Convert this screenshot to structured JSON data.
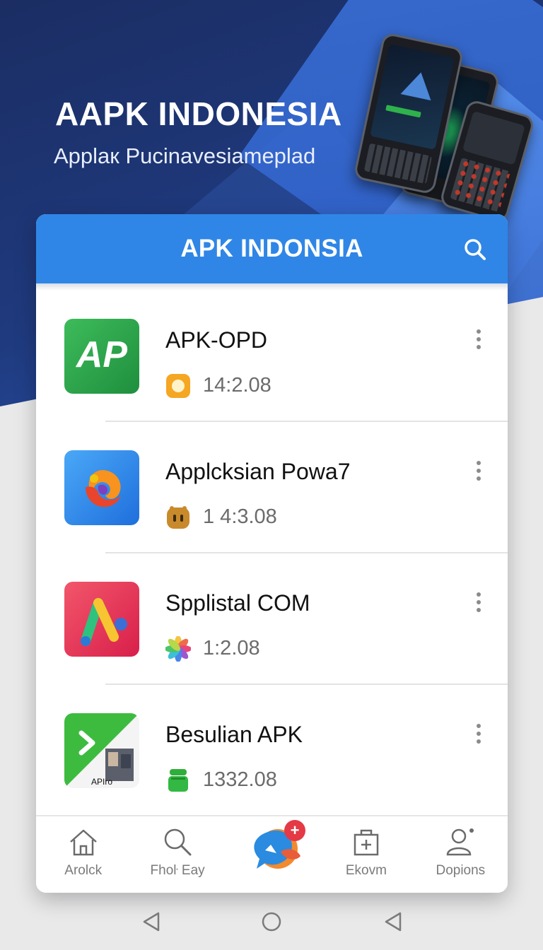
{
  "hero": {
    "title": "AAPK INDONESIA",
    "subtitle": "Applaк Pucinavesiameplad"
  },
  "header": {
    "title": "APK INDONSIA",
    "search_icon": "search-icon"
  },
  "apps": [
    {
      "name": "APK-OPD",
      "meta": "14:2.08",
      "icon": "ap-logo-green",
      "meta_icon": "orange-circle-badge"
    },
    {
      "name": "Applcksian Powa7",
      "meta": "1 4:3.08",
      "icon": "blue-swirl-logo",
      "meta_icon": "gold-face-badge"
    },
    {
      "name": "Spplistal COM",
      "meta": "1:2.08",
      "icon": "red-chart-logo",
      "meta_icon": "pinwheel-badge"
    },
    {
      "name": "Besulian APK",
      "meta": "1332.08",
      "icon": "green-play-logo",
      "meta_icon": "android-robot-badge",
      "icon_text": "APIro"
    }
  ],
  "bottom_nav": [
    {
      "label": "Arolck",
      "icon": "home-icon"
    },
    {
      "label": "Fhoŀ Eay",
      "icon": "search-icon"
    },
    {
      "label": "",
      "icon": "chat-bubbles-plus-icon",
      "badge": "+"
    },
    {
      "label": "Ekovm",
      "icon": "medical-box-icon"
    },
    {
      "label": "Dopions",
      "icon": "user-settings-icon"
    }
  ],
  "colors": {
    "header_blue": "#2f86e6",
    "hero_navy": "#1f3a7e",
    "badge_red": "#e53945"
  }
}
